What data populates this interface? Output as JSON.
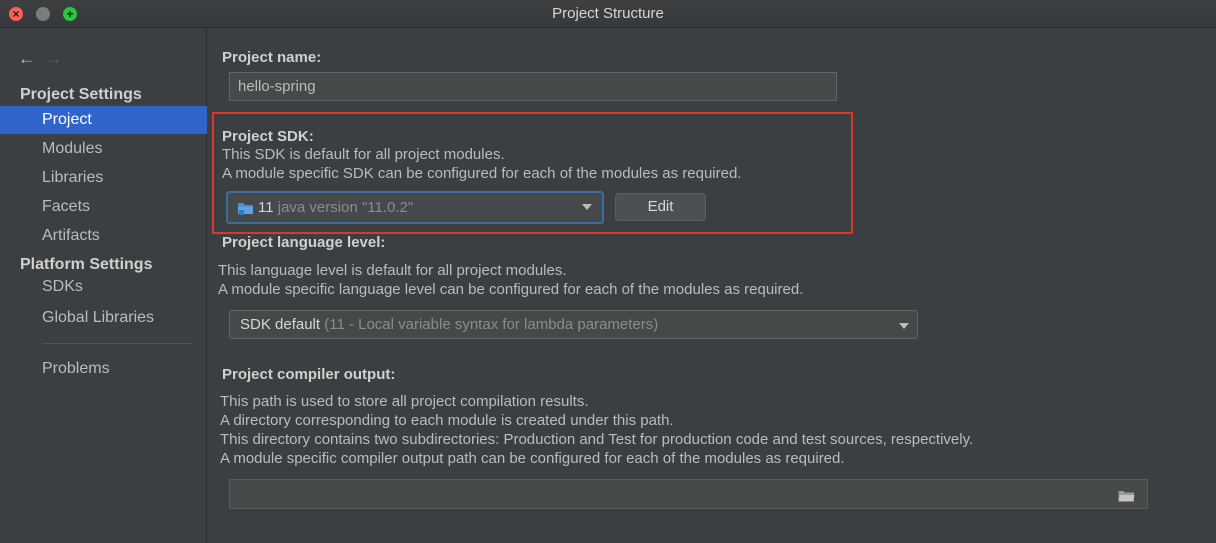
{
  "window": {
    "title": "Project Structure"
  },
  "traffic_lights": {
    "close_glyph": "×",
    "max_glyph": "+"
  },
  "nav": {
    "back_glyph": "←",
    "forward_glyph": "→"
  },
  "sidebar": {
    "project_settings_header": "Project Settings",
    "platform_settings_header": "Platform Settings",
    "items": [
      {
        "label": "Project",
        "selected": true
      },
      {
        "label": "Modules"
      },
      {
        "label": "Libraries"
      },
      {
        "label": "Facets"
      },
      {
        "label": "Artifacts"
      },
      {
        "label": "SDKs"
      },
      {
        "label": "Global Libraries"
      },
      {
        "label": "Problems"
      }
    ]
  },
  "project_name": {
    "label": "Project name:",
    "value": "hello-spring"
  },
  "project_sdk": {
    "label": "Project SDK:",
    "desc1": "This SDK is default for all project modules.",
    "desc2": "A module specific SDK can be configured for each of the modules as required.",
    "selected_version": "11",
    "selected_detail": "java version \"11.0.2\"",
    "icon": "folder-icon",
    "edit_label": "Edit"
  },
  "language_level": {
    "label": "Project language level:",
    "desc1": "This language level is default for all project modules.",
    "desc2": "A module specific language level can be configured for each of the modules as required.",
    "selected_main": "SDK default",
    "selected_detail": "(11 - Local variable syntax for lambda parameters)"
  },
  "compiler_output": {
    "label": "Project compiler output:",
    "desc1": "This path is used to store all project compilation results.",
    "desc2": "A directory corresponding to each module is created under this path.",
    "desc3": "This directory contains two subdirectories: Production and Test for production code and test sources, respectively.",
    "desc4": "A module specific compiler output path can be configured for each of the modules as required.",
    "value": ""
  },
  "colors": {
    "background": "#3c3f41",
    "selection": "#2f65ca",
    "highlight": "#e0352b",
    "focus_border": "#3f6e9e"
  }
}
